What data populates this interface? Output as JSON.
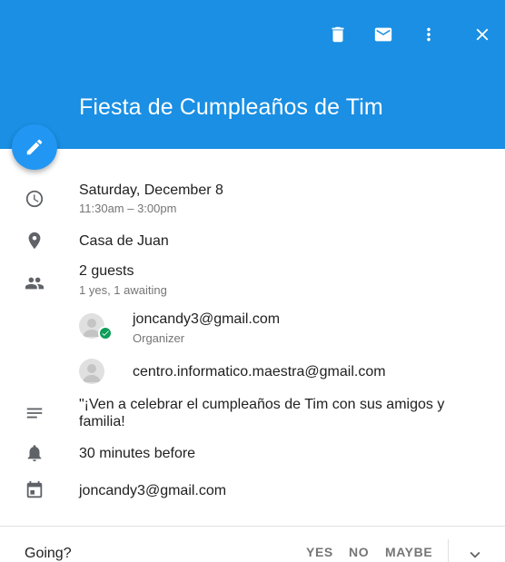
{
  "header": {
    "title": "Fiesta de Cumpleaños de Tim",
    "background_color": "#1a8fe3",
    "actions": [
      "delete-icon",
      "email-icon",
      "more-vert-icon",
      "close-icon"
    ]
  },
  "fab": {
    "icon": "edit-icon",
    "color": "#2196f3"
  },
  "event": {
    "date": "Saturday, December 8",
    "time": "11:30am – 3:00pm",
    "location": "Casa de Juan",
    "guests_title": "2 guests",
    "guests_summary": "1 yes, 1 awaiting",
    "guests": [
      {
        "email": "joncandy3@gmail.com",
        "role": "Organizer",
        "status": "accepted"
      },
      {
        "email": "centro.informatico.maestra@gmail.com",
        "role": "",
        "status": "awaiting"
      }
    ],
    "description": "\"¡Ven a celebrar el cumpleaños de Tim con sus amigos y familia!",
    "reminder": "30 minutes before",
    "calendar": "joncandy3@gmail.com"
  },
  "rsvp": {
    "label": "Going?",
    "yes": "YES",
    "no": "NO",
    "maybe": "MAYBE"
  }
}
